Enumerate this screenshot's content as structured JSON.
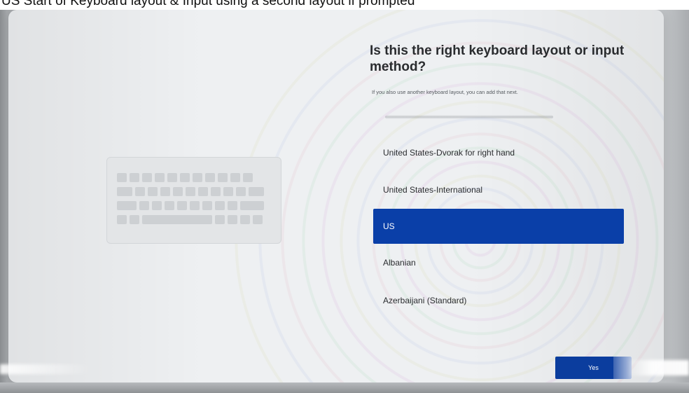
{
  "caption": "US Start of Keyboard layout & Input using a second layout if prompted",
  "setup": {
    "title": "Is this the right keyboard layout or input method?",
    "subtitle": "If you also use another keyboard layout, you can add that next.",
    "layouts": [
      {
        "label": "United States-Dvorak for right hand",
        "selected": false
      },
      {
        "label": "United States-International",
        "selected": false
      },
      {
        "label": "US",
        "selected": true
      },
      {
        "label": "Albanian",
        "selected": false
      },
      {
        "label": "Azerbaijani (Standard)",
        "selected": false
      }
    ],
    "yes_label": "Yes"
  },
  "colors": {
    "accent": "#0a3fa8",
    "background": "#eef0f2"
  },
  "icons": {
    "illustration": "keyboard-icon"
  }
}
